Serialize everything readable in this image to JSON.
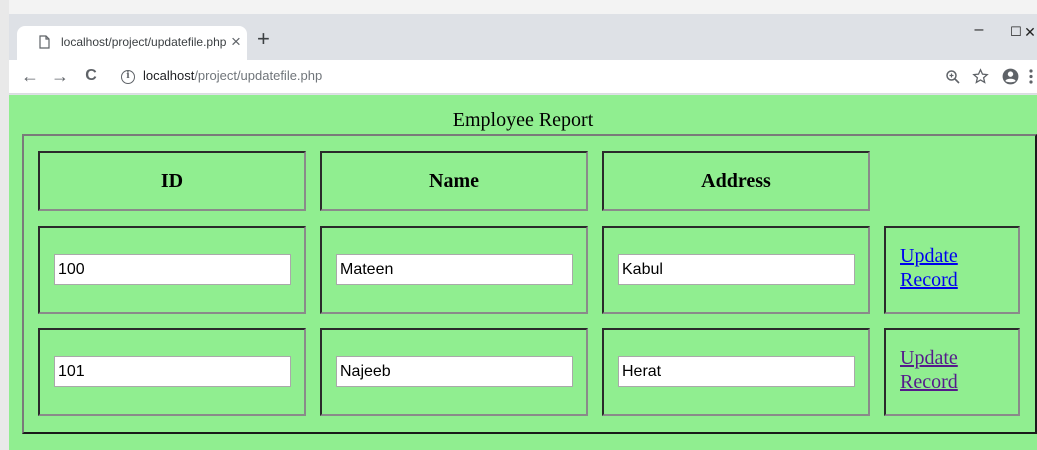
{
  "browser": {
    "tab_title": "localhost/project/updatefile.php",
    "tab_close": "×",
    "new_tab": "+",
    "window_controls": {
      "minimize": "–",
      "maximize": "☐",
      "close": "✕"
    },
    "nav": {
      "back": "←",
      "forward": "→",
      "reload": "C"
    },
    "url_host": "localhost",
    "url_path": "/project/updatefile.php",
    "icons": [
      "page-icon",
      "info-icon",
      "zoom-icon",
      "star-icon",
      "account-icon",
      "menu-icon"
    ]
  },
  "page": {
    "title": "Employee Report",
    "headers": [
      "ID",
      "Name",
      "Address"
    ],
    "rows": [
      {
        "id": "100",
        "name": "Mateen",
        "address": "Kabul",
        "link_line1": "Update",
        "link_line2": "Record",
        "link_state": "unvisited"
      },
      {
        "id": "101",
        "name": "Najeeb",
        "address": "Herat",
        "link_line1": "Update",
        "link_line2": "Record",
        "link_state": "visited"
      }
    ],
    "colors": {
      "background": "#90ee90",
      "link": "#0000ee",
      "visited_link": "#551a8b"
    }
  }
}
